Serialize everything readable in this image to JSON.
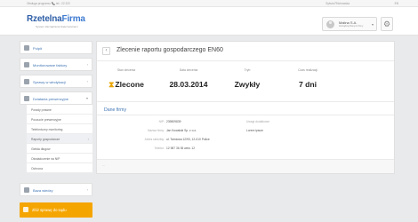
{
  "topbar": {
    "hotline": "Obsługa programu: 📞 tel.: 22 222",
    "user_link": "Sylwia Pilichowska",
    "lang_icon": "globe-icon",
    "lang": "EN"
  },
  "brand": {
    "name_part1": "Rzetelna",
    "name_part2": "Firma",
    "tagline": "System Zarządzania Należnościami"
  },
  "account": {
    "name": "Malina S.A.",
    "sub": "Zarządzaj Danymi firmy"
  },
  "sidebar": {
    "items": [
      {
        "label": "Pulpit",
        "icon": "dashboard-icon"
      },
      {
        "label": "Monitorowane faktury",
        "icon": "invoice-icon"
      },
      {
        "label": "Sprawy w windykacji",
        "icon": "case-icon"
      },
      {
        "label": "Działania prewencyjne",
        "icon": "shield-icon"
      }
    ],
    "subitems": [
      "Porady prawne",
      "Poczucie prewencyjne",
      "Telefoniczny monitoring",
      "Raporty gospodarcze",
      "Giełda długów",
      "Oświadczenie na NIP",
      "Ochrona"
    ],
    "bottom_item": {
      "label": "Baza wiedzy",
      "icon": "book-icon"
    },
    "promo": {
      "label": "Zlóż sprawę do sądu",
      "icon": "gavel-icon"
    }
  },
  "page": {
    "title": "Zlecenie raportu gospodarczego EN60",
    "stats": [
      {
        "header": "Stan zlecenia",
        "value": "Zlecone",
        "icon": "hourglass-icon"
      },
      {
        "header": "Data zlecenia",
        "value": "28.03.2014"
      },
      {
        "header": "Tryb",
        "value": "Zwykły"
      },
      {
        "header": "Czas realizacji",
        "value": "7 dni"
      }
    ],
    "section_title": "Dane firmy",
    "fields": [
      {
        "key": "NIP:",
        "value": "239809839"
      },
      {
        "key": "Nazwa firmy:",
        "value": "Jan Kowalski Sp. z o.o."
      },
      {
        "key": "Adres siedziby:",
        "value": "ul. Tarniowa 12/93, 12-010 Police"
      },
      {
        "key": "Telefon:",
        "value": "12 987 36 35 wew. 12"
      }
    ],
    "note_label": "Uwagi dodatkowe",
    "note_value": "Lorem ipsum"
  }
}
